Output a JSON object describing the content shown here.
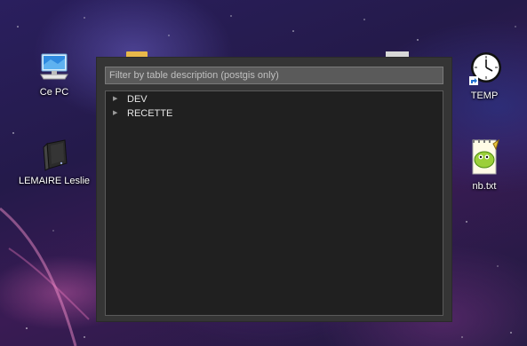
{
  "desktop": {
    "icons": [
      {
        "label": "Ce PC",
        "icon": "computer-icon"
      },
      {
        "label": "LEMAIRE Leslie",
        "icon": "hard-drive-icon"
      },
      {
        "label": "TEMP",
        "icon": "clock-icon"
      },
      {
        "label": "nb.txt",
        "icon": "notepad-plus-plus-icon"
      }
    ]
  },
  "dialog": {
    "filter": {
      "placeholder": "Filter by table description (postgis only)",
      "value": ""
    },
    "tree": {
      "items": [
        {
          "label": "DEV",
          "expander": "▶"
        },
        {
          "label": "RECETTE",
          "expander": "▶"
        }
      ]
    }
  },
  "colors": {
    "dialog_bg": "#353535",
    "tree_bg": "#202020",
    "filter_bg": "#5a5a5a",
    "text": "#e6e6e6"
  }
}
